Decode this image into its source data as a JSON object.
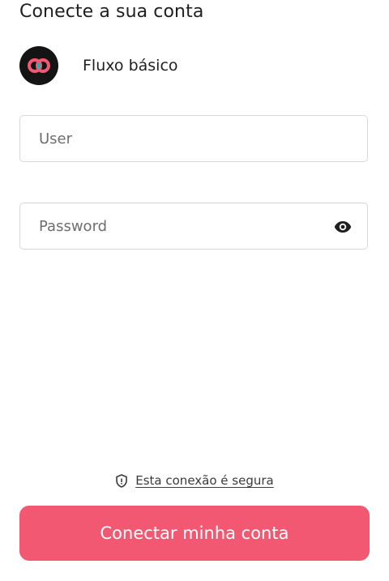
{
  "header": {
    "title": "Conecte a sua conta"
  },
  "app": {
    "name": "Fluxo básico",
    "logo_icon": "linked-rings-logo",
    "logo_colors": {
      "background": "#141414",
      "ring_left": "#f25872",
      "ring_right": "#f25872",
      "overlap": "#1fb8a6"
    }
  },
  "form": {
    "user": {
      "placeholder": "User",
      "value": ""
    },
    "password": {
      "placeholder": "Password",
      "value": "",
      "toggle_icon": "eye-icon"
    }
  },
  "footer": {
    "secure_icon": "shield-icon",
    "secure_text": "Esta conexão é segura",
    "submit_label": "Conectar minha conta"
  },
  "colors": {
    "accent": "#f25872",
    "border": "#d8d8d8",
    "text": "#1f1f1f"
  }
}
